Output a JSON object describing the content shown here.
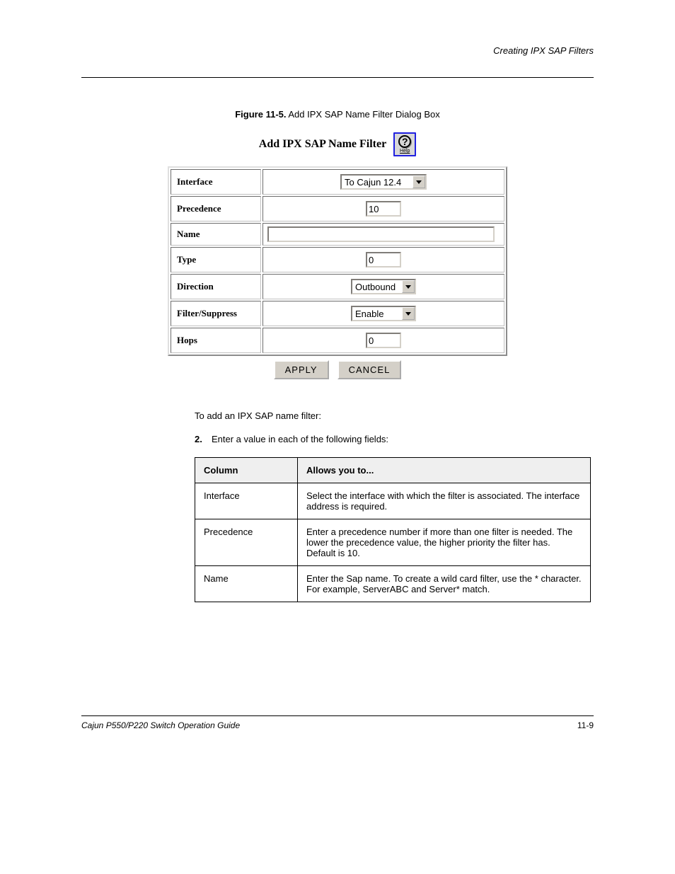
{
  "header_right": "Creating IPX SAP Filters",
  "figure_caption_bold": "Figure 11-5.",
  "figure_caption_text": "Add IPX SAP Name Filter Dialog Box",
  "form": {
    "title": "Add IPX SAP Name Filter",
    "help_label": "Help",
    "rows": {
      "interface": {
        "label": "Interface",
        "value": "To Cajun 12.4"
      },
      "precedence": {
        "label": "Precedence",
        "value": "10"
      },
      "name": {
        "label": "Name",
        "value": ""
      },
      "type": {
        "label": "Type",
        "value": "0"
      },
      "direction": {
        "label": "Direction",
        "value": "Outbound"
      },
      "filter_suppress": {
        "label": "Filter/Suppress",
        "value": "Enable"
      },
      "hops": {
        "label": "Hops",
        "value": "0"
      }
    },
    "buttons": {
      "apply": "APPLY",
      "cancel": "CANCEL"
    }
  },
  "body": {
    "line1": "To add an IPX SAP name filter:",
    "step_num": "2.",
    "step_text": "Enter a value in each of the following fields:"
  },
  "ref_table": {
    "headers": {
      "col1": "Column",
      "col2": "Allows you to..."
    },
    "rows": [
      {
        "col1": "Interface",
        "col2": "Select the interface with which the filter is associated. The interface address is required."
      },
      {
        "col1": "Precedence",
        "col2": "Enter a precedence number if more than one filter is needed. The lower the precedence value, the higher priority the filter has. Default is 10."
      },
      {
        "col1": "Name",
        "col2": "Enter the Sap name. To create a wild card filter, use the * character. For example, ServerABC and Server* match."
      }
    ]
  },
  "footer": {
    "left": "Cajun P550/P220 Switch Operation Guide",
    "right": "11-9"
  }
}
